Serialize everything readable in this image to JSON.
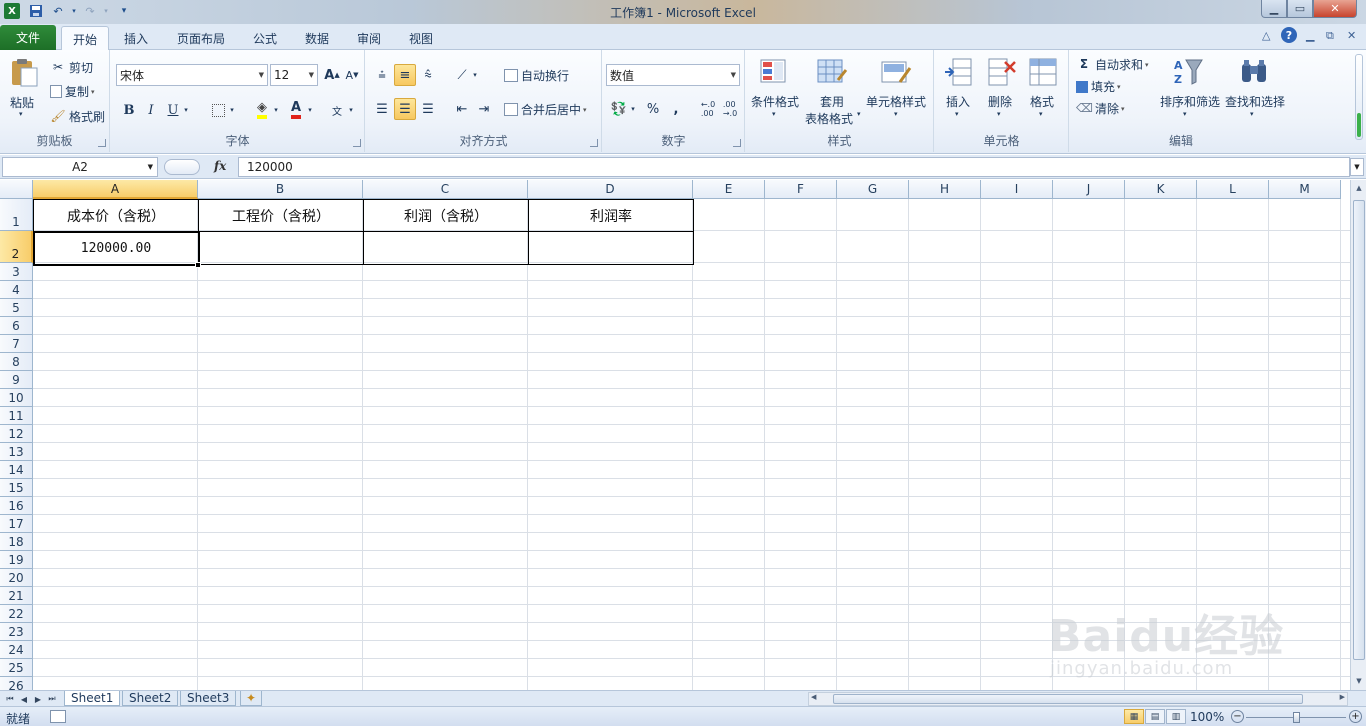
{
  "window": {
    "title": "工作簿1 - Microsoft Excel"
  },
  "tabs": {
    "file": "文件",
    "items": [
      "开始",
      "插入",
      "页面布局",
      "公式",
      "数据",
      "审阅",
      "视图"
    ]
  },
  "ribbon": {
    "clipboard": {
      "paste": "粘贴",
      "cut": "剪切",
      "copy": "复制",
      "format_painter": "格式刷",
      "label": "剪贴板"
    },
    "font": {
      "name": "宋体",
      "size": "12",
      "label": "字体",
      "bold": "B",
      "italic": "I",
      "underline": "U"
    },
    "alignment": {
      "wrap": "自动换行",
      "merge": "合并后居中",
      "label": "对齐方式"
    },
    "number": {
      "format": "数值",
      "percent": "%",
      "comma": ",",
      "label": "数字"
    },
    "styles": {
      "conditional": "条件格式",
      "table_1": "套用",
      "table_2": "表格格式",
      "cell_styles": "单元格样式",
      "label": "样式"
    },
    "cells": {
      "insert": "插入",
      "delete": "删除",
      "format": "格式",
      "label": "单元格"
    },
    "editing": {
      "autosum": "自动求和",
      "fill": "填充",
      "clear": "清除",
      "sort": "排序和筛选",
      "find": "查找和选择",
      "label": "编辑"
    }
  },
  "formula_bar": {
    "name_box": "A2",
    "fx": "fx",
    "value": "120000"
  },
  "grid": {
    "columns": [
      "A",
      "B",
      "C",
      "D",
      "E",
      "F",
      "G",
      "H",
      "I",
      "J",
      "K",
      "L",
      "M"
    ],
    "rows": [
      "1",
      "2",
      "3",
      "4",
      "5",
      "6",
      "7",
      "8",
      "9",
      "10",
      "11",
      "12",
      "13",
      "14",
      "15",
      "16",
      "17",
      "18",
      "19",
      "20",
      "21",
      "22",
      "23",
      "24",
      "25",
      "26"
    ],
    "selected_cell": "A2",
    "cells": {
      "A1": "成本价（含税）",
      "B1": "工程价（含税）",
      "C1": "利润（含税）",
      "D1": "利润率",
      "A2": "120000.00"
    }
  },
  "sheets": {
    "items": [
      "Sheet1",
      "Sheet2",
      "Sheet3"
    ],
    "active": "Sheet1"
  },
  "status": {
    "text": "就绪",
    "zoom": "100%"
  },
  "watermark": {
    "brand": "Baidu经验",
    "url": "jingyan.baidu.com"
  },
  "colors": {
    "file_tab": "#2f8b3a",
    "selected_header": "#f8cd6a",
    "ribbon_bg": "#eef3fa"
  }
}
